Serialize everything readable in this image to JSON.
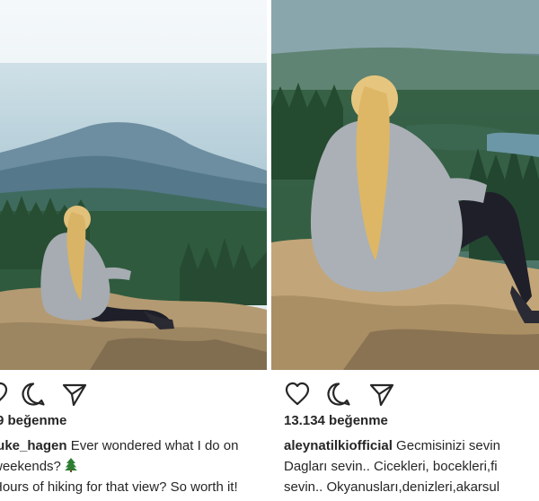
{
  "left_post": {
    "likes": "9 beğenme",
    "caption_user": "luke_hagen",
    "caption_line1": " Ever wondered what I do on",
    "caption_line2": "weekends?",
    "caption_line2_icon": "tree-icon",
    "caption_line3": "Hours of hiking for that view? So worth it!"
  },
  "right_post": {
    "likes": "13.134 beğenme",
    "caption_user": "aleynatilkiofficial",
    "caption_line1": " Gecmisinizi sevin",
    "caption_line2": "Dagları sevin.. Cicekleri, bocekleri,fi",
    "caption_line3": "sevin.. Okyanusları,denizleri,akarsul"
  },
  "icons": {
    "like": "heart-icon",
    "comment": "comment-icon",
    "share": "send-icon"
  },
  "colors": {
    "text": "#262626",
    "background": "#ffffff"
  }
}
